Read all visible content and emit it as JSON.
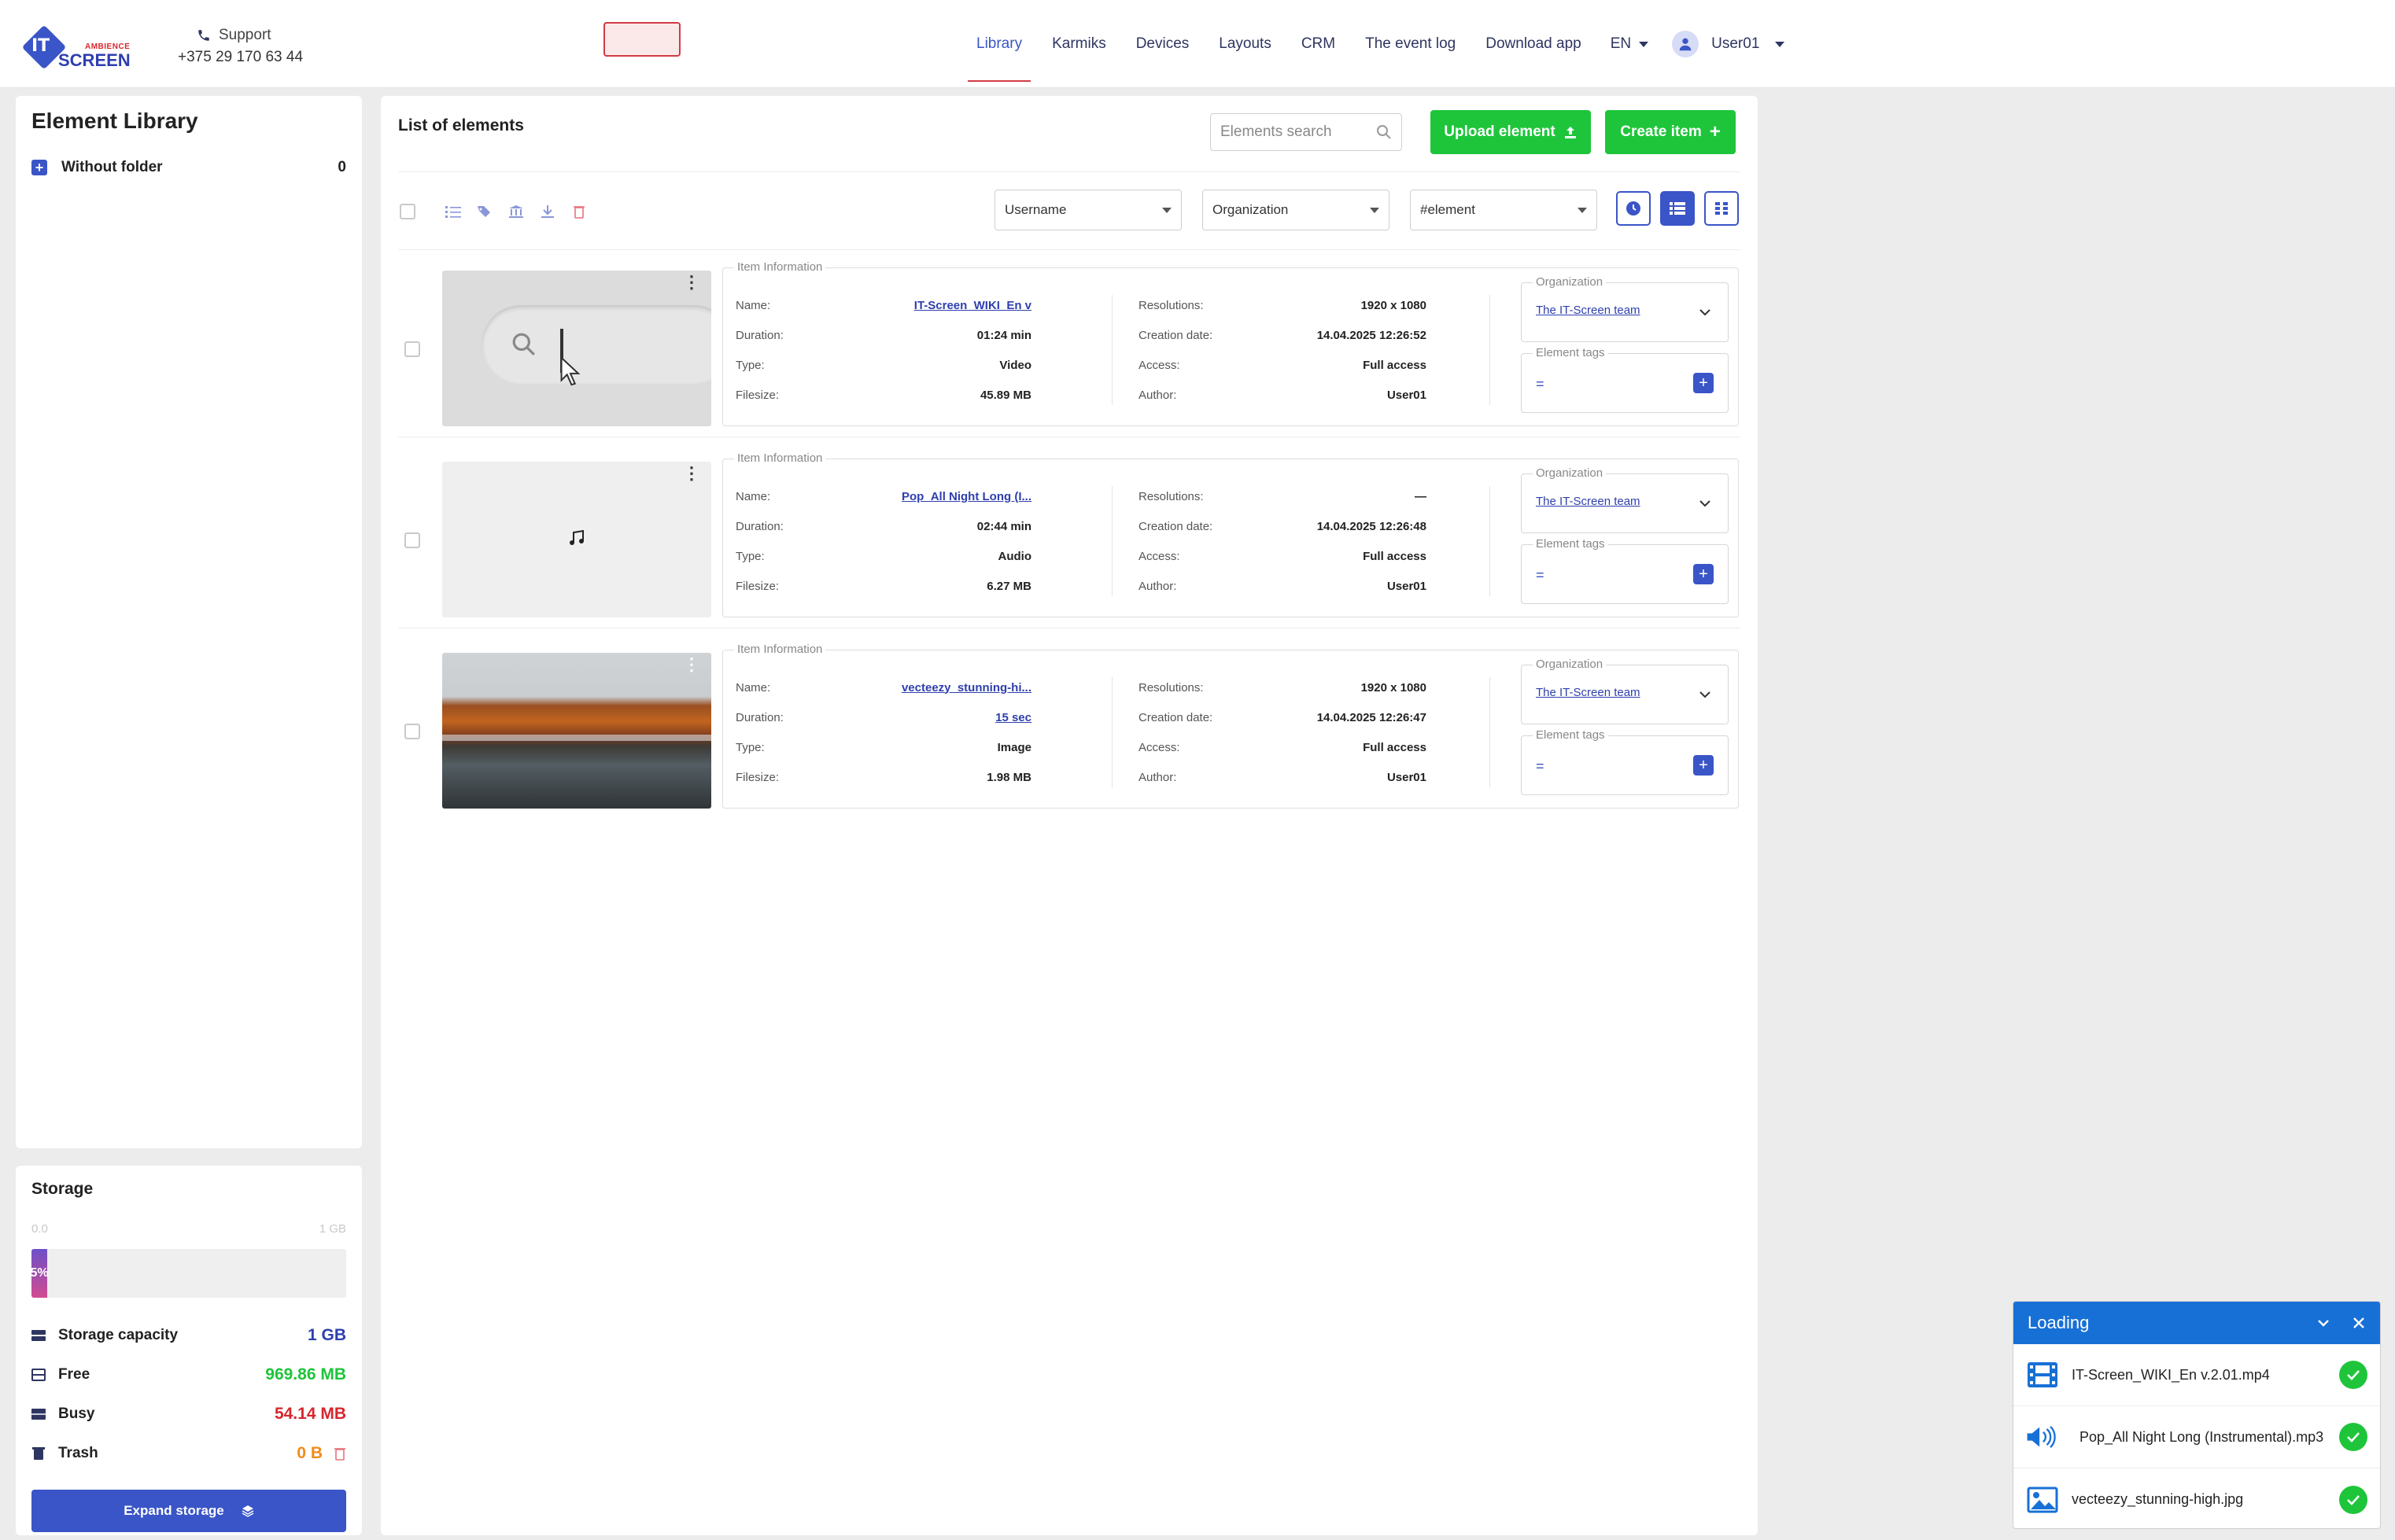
{
  "header": {
    "support_label": "Support",
    "support_phone": "+375 29 170 63 44",
    "logo_it": "IT",
    "logo_ambience": "AMBIENCE",
    "logo_screen": "SCREEN",
    "nav": [
      "Library",
      "Karmiks",
      "Devices",
      "Layouts",
      "CRM",
      "The event log",
      "Download app"
    ],
    "lang": "EN",
    "user": "User01"
  },
  "sidebar": {
    "title": "Element Library",
    "folder_label": "Without folder",
    "folder_count": "0"
  },
  "storage": {
    "title": "Storage",
    "scale_min": "0.0",
    "scale_max": "1 GB",
    "used_percent_label": "5%",
    "used_fraction": 0.05,
    "rows": [
      {
        "label": "Storage capacity",
        "value": "1 GB",
        "color": "#2e3fae"
      },
      {
        "label": "Free",
        "value": "969.86 MB",
        "color": "#1ec53a"
      },
      {
        "label": "Busy",
        "value": "54.14 MB",
        "color": "#d8262e"
      },
      {
        "label": "Trash",
        "value": "0 B",
        "color": "#f08c1a"
      }
    ],
    "expand_label": "Expand storage"
  },
  "main": {
    "title": "List of elements",
    "search_placeholder": "Elements search",
    "upload_label": "Upload element",
    "create_label": "Create item",
    "filters": {
      "username": "Username",
      "organization": "Organization",
      "element": "#element"
    },
    "legend_info": "Item Information",
    "legend_org": "Organization",
    "legend_tags": "Element tags",
    "labels": {
      "name": "Name:",
      "duration": "Duration:",
      "type": "Type:",
      "filesize": "Filesize:",
      "resolutions": "Resolutions:",
      "creation": "Creation date:",
      "access": "Access:",
      "author": "Author:"
    },
    "items": [
      {
        "name": "IT-Screen_WIKI_En v",
        "duration": "01:24 min",
        "type": "Video",
        "filesize": "45.89 MB",
        "resolution": "1920 x 1080",
        "created": "14.04.2025 12:26:52",
        "access": "Full access",
        "author": "User01",
        "organization": "The IT-Screen team",
        "tags": "="
      },
      {
        "name": "Pop_All Night Long (I...",
        "duration": "02:44 min",
        "type": "Audio",
        "filesize": "6.27 MB",
        "resolution": "—",
        "created": "14.04.2025 12:26:48",
        "access": "Full access",
        "author": "User01",
        "organization": "The IT-Screen team",
        "tags": "="
      },
      {
        "name": "vecteezy_stunning-hi...",
        "duration": "15 sec",
        "type": "Image",
        "filesize": "1.98 MB",
        "resolution": "1920 x 1080",
        "created": "14.04.2025 12:26:47",
        "access": "Full access",
        "author": "User01",
        "organization": "The IT-Screen team",
        "tags": "="
      }
    ]
  },
  "loading": {
    "title": "Loading",
    "files": [
      "IT-Screen_WIKI_En v.2.01.mp4",
      "Pop_All Night Long (Instrumental).mp3",
      "vecteezy_stunning-high.jpg"
    ]
  }
}
